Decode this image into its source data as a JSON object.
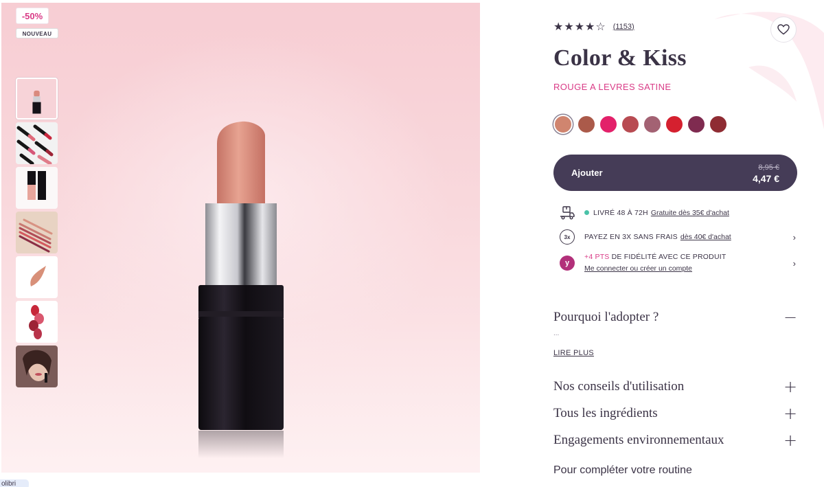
{
  "badges": {
    "discount": "-50%",
    "new": "NOUVEAU"
  },
  "gallery": {
    "thumbnails": [
      "lipstick-pack-shot",
      "lipstick-collection",
      "packaging",
      "swatches-on-arm",
      "texture-smudge",
      "lipstick-tips",
      "model-applying-lipstick"
    ]
  },
  "product": {
    "stars": "★★★★☆",
    "review_count": "(1153)",
    "name": "Color & Kiss",
    "subtitle": "ROUGE A LEVRES SATINE",
    "shades": [
      "#d0856f",
      "#ab5a4a",
      "#e3216a",
      "#b84b52",
      "#a36273",
      "#d5202f",
      "#7f2b50",
      "#8f2c33"
    ],
    "selected_shade": 0
  },
  "cart": {
    "add_label": "Ajouter",
    "old_price": "8,95 €",
    "price": "4,47 €"
  },
  "info": {
    "delivery_label": "LIVRÉ 48 À 72H",
    "delivery_link": "Gratuite dès 35€ d'achat",
    "payment_label": "PAYEZ EN 3X SANS FRAIS",
    "payment_link": "dès 40€ d'achat",
    "payment_icon": "3x",
    "loyalty_points": "+4 PTS",
    "loyalty_label": "DE FIDÉLITÉ AVEC CE PRODUIT",
    "loyalty_link": "Me connecter ou créer un compte",
    "loyalty_icon": "y"
  },
  "accordion": {
    "why": "Pourquoi l'adopter ?",
    "why_excerpt": "...",
    "read_more": "LIRE PLUS",
    "usage": "Nos conseils d'utilisation",
    "ingredients": "Tous les ingrédients",
    "environment": "Engagements environnementaux"
  },
  "routine_title": "Pour compléter votre routine",
  "chip_label": "olibri",
  "colors": {
    "brand_dark": "#453c57",
    "accent_pink": "#d93a86",
    "delivery_dot": "#4ac2a8"
  }
}
